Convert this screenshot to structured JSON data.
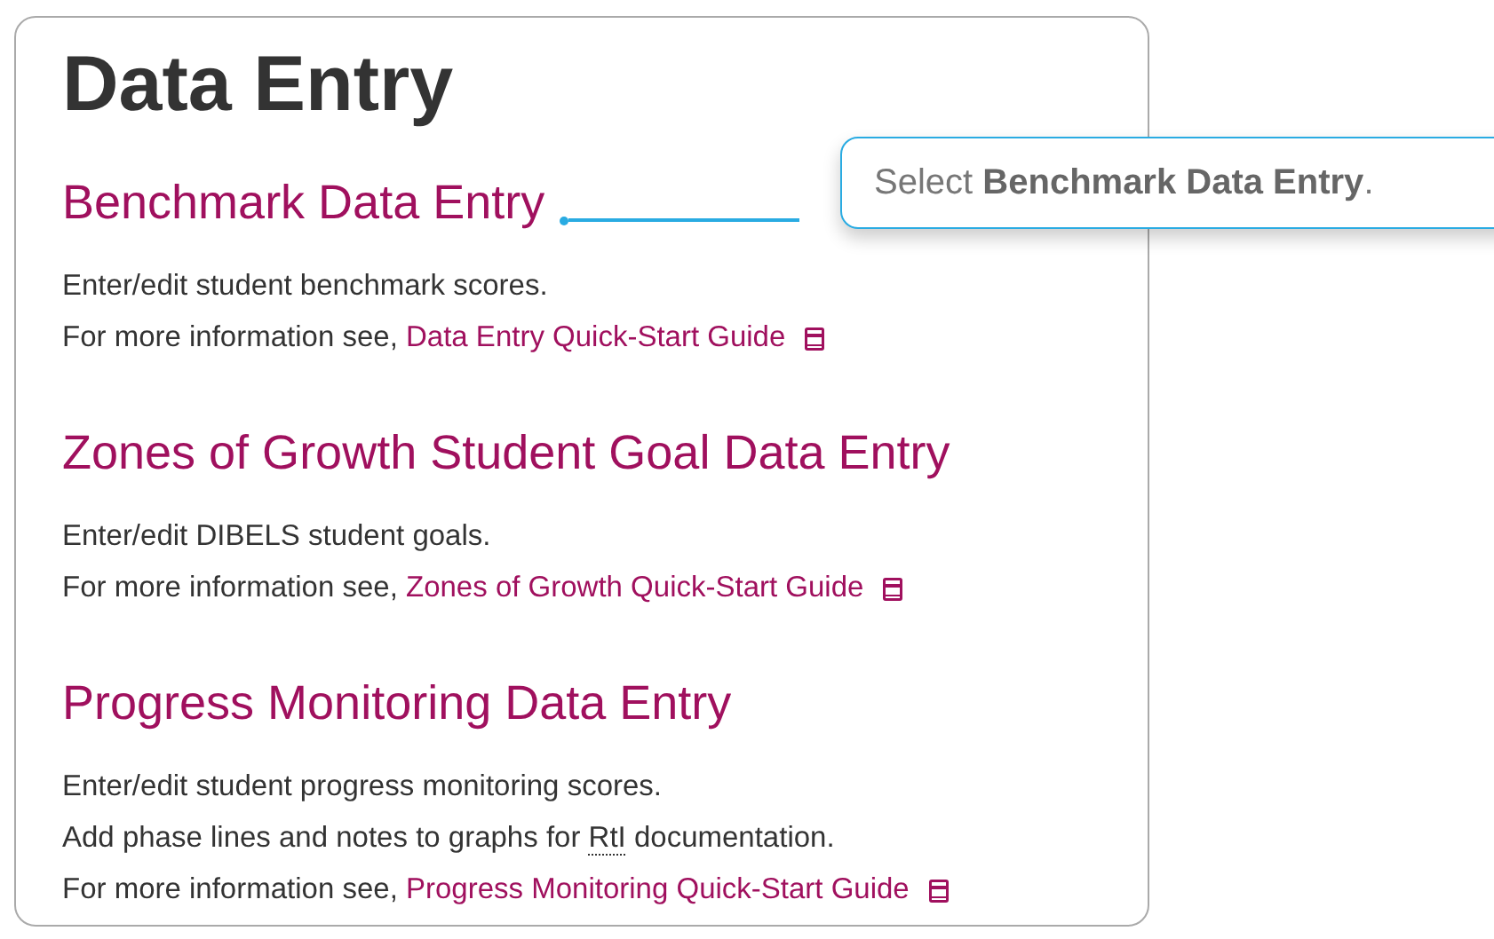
{
  "title": "Data Entry",
  "sections": [
    {
      "heading": "Benchmark Data Entry",
      "lines": [
        [
          {
            "kind": "text",
            "text": "Enter/edit student benchmark scores."
          }
        ]
      ],
      "more_prefix": "For more information see, ",
      "link": "Data Entry Quick-Start Guide",
      "callout": true
    },
    {
      "heading": "Zones of Growth Student Goal Data Entry",
      "lines": [
        [
          {
            "kind": "text",
            "text": "Enter/edit DIBELS student goals."
          }
        ]
      ],
      "more_prefix": "For more information see, ",
      "link": "Zones of Growth Quick-Start Guide",
      "callout": false
    },
    {
      "heading": "Progress Monitoring Data Entry",
      "lines": [
        [
          {
            "kind": "text",
            "text": "Enter/edit student progress monitoring scores."
          }
        ],
        [
          {
            "kind": "text",
            "text": "Add phase lines and notes to graphs for "
          },
          {
            "kind": "abbr",
            "text": "RtI"
          },
          {
            "kind": "text",
            "text": " documentation."
          }
        ]
      ],
      "more_prefix": "For more information see, ",
      "link": "Progress Monitoring Quick-Start Guide",
      "callout": false
    }
  ],
  "tooltip": {
    "text": "Select **Benchmark Data Entry**."
  }
}
